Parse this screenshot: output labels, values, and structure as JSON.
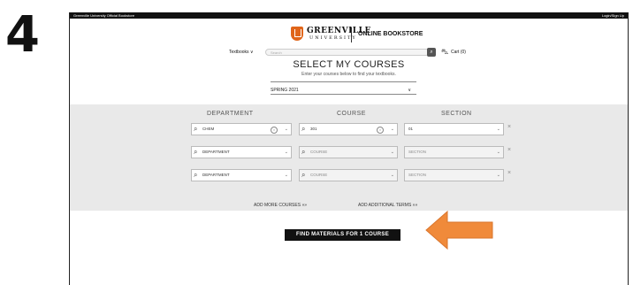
{
  "step_number": "4",
  "topbar": {
    "left_text": "Greenville University Official Bookstore",
    "right_text": "Login/Sign Up"
  },
  "logo": {
    "name": "GREENVILLE",
    "subname": "UNIVERSITY",
    "store_label": "ONLINE BOOKSTORE"
  },
  "nav": {
    "textbooks_label": "Textbooks ∨",
    "search_placeholder": "Search",
    "cart_label": "Cart (0)"
  },
  "page": {
    "title": "SELECT MY COURSES",
    "subtitle": "Enter your courses below to find your textbooks.",
    "term_value": "SPRING 2021",
    "term_chevron": "∨"
  },
  "columns": {
    "department": "DEPARTMENT",
    "course": "COURSE",
    "section": "SECTION"
  },
  "rows": [
    {
      "department": "CHEM",
      "course": "301",
      "section": "01"
    },
    {
      "department": "DEPARTMENT",
      "course": "COURSE",
      "section": "SECTION"
    },
    {
      "department": "DEPARTMENT",
      "course": "COURSE",
      "section": "SECTION"
    }
  ],
  "links": {
    "add_courses": "ADD MORE COURSES »»",
    "add_terms": "ADD ADDITIONAL TERMS »»"
  },
  "find_button": "FIND MATERIALS FOR 1 COURSE",
  "colors": {
    "accent": "#e0651a",
    "arrow": "#f08a3a",
    "band": "#e9e9e9"
  },
  "icons": {
    "search": "search-icon",
    "cart": "cart-icon",
    "clear": "clear-icon",
    "remove": "remove-row-icon"
  }
}
